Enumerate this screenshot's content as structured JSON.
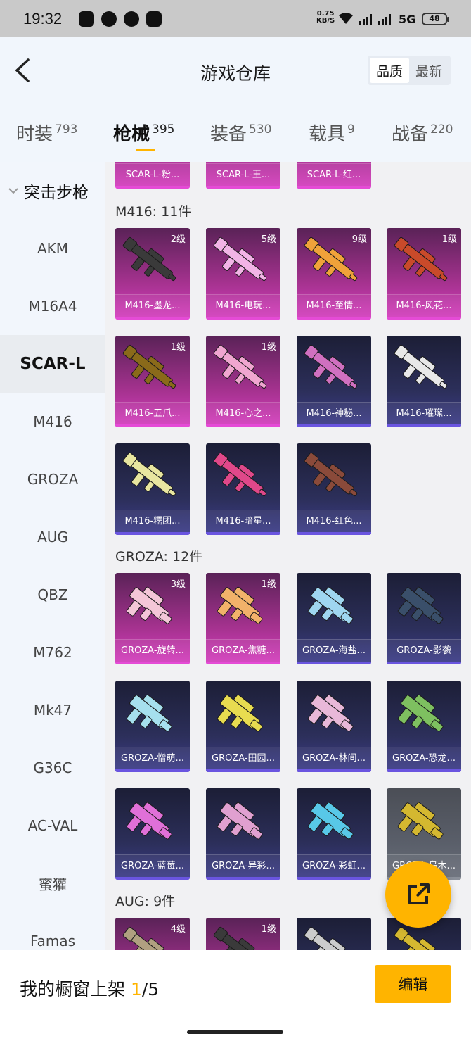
{
  "status_bar": {
    "time": "19:32",
    "speed": "0.75",
    "speed_unit": "KB/S",
    "network": "5G",
    "battery": "48"
  },
  "header": {
    "title": "游戏仓库",
    "sort_options": [
      "品质",
      "最新"
    ],
    "active_sort": "品质"
  },
  "tabs": [
    {
      "label": "时装",
      "count": "793"
    },
    {
      "label": "枪械",
      "count": "395"
    },
    {
      "label": "装备",
      "count": "530"
    },
    {
      "label": "载具",
      "count": "9"
    },
    {
      "label": "战备",
      "count": "220"
    }
  ],
  "active_tab": "枪械",
  "sidebar": {
    "group": "突击步枪",
    "items": [
      "AKM",
      "M16A4",
      "SCAR-L",
      "M416",
      "GROZA",
      "AUG",
      "QBZ",
      "M762",
      "Mk47",
      "G36C",
      "AC-VAL",
      "蜜獾",
      "Famas"
    ],
    "active": "SCAR-L"
  },
  "top_partial_cards": [
    {
      "name": "SCAR-L-粉...",
      "style": "pink"
    },
    {
      "name": "SCAR-L-王...",
      "style": "pink"
    },
    {
      "name": "SCAR-L-红...",
      "style": "pink"
    }
  ],
  "sections": [
    {
      "title": "M416: 11件",
      "items": [
        {
          "name": "M416-墨龙...",
          "level": "2级",
          "style": "pink",
          "color": "#3a3a3a"
        },
        {
          "name": "M416-电玩...",
          "level": "5级",
          "style": "pink",
          "color": "#f2b4e6"
        },
        {
          "name": "M416-至情...",
          "level": "9级",
          "style": "pink",
          "color": "#f0a23a"
        },
        {
          "name": "M416-风花...",
          "level": "1级",
          "style": "pink",
          "color": "#c94a2a"
        },
        {
          "name": "M416-五爪...",
          "level": "1级",
          "style": "pink",
          "color": "#8a6a1a"
        },
        {
          "name": "M416-心之...",
          "level": "1级",
          "style": "pink",
          "color": "#f0a6d0"
        },
        {
          "name": "M416-神秘...",
          "level": "",
          "style": "blue",
          "color": "#d070c0"
        },
        {
          "name": "M416-璀璨...",
          "level": "",
          "style": "blue",
          "color": "#e8e8e8"
        },
        {
          "name": "M416-糯团...",
          "level": "",
          "style": "blue",
          "color": "#e8e6a0"
        },
        {
          "name": "M416-暗星...",
          "level": "",
          "style": "blue",
          "color": "#e0488a"
        },
        {
          "name": "M416-红色...",
          "level": "",
          "style": "blue",
          "color": "#8a4a3a"
        }
      ]
    },
    {
      "title": "GROZA: 12件",
      "items": [
        {
          "name": "GROZA-旋转...",
          "level": "3级",
          "style": "pink",
          "color": "#f4c6d8"
        },
        {
          "name": "GROZA-焦糖...",
          "level": "1级",
          "style": "pink",
          "color": "#f2b26a"
        },
        {
          "name": "GROZA-海盐...",
          "level": "",
          "style": "blue",
          "color": "#9fd6f0"
        },
        {
          "name": "GROZA-影袭",
          "level": "",
          "style": "blue",
          "color": "#3a4f6a"
        },
        {
          "name": "GROZA-憎萌...",
          "level": "",
          "style": "blue",
          "color": "#a6e0ee"
        },
        {
          "name": "GROZA-田园...",
          "level": "",
          "style": "blue",
          "color": "#e8dc50"
        },
        {
          "name": "GROZA-林间...",
          "level": "",
          "style": "blue",
          "color": "#e8b8d8"
        },
        {
          "name": "GROZA-恐龙...",
          "level": "",
          "style": "blue",
          "color": "#7ec060"
        },
        {
          "name": "GROZA-蓝莓...",
          "level": "",
          "style": "blue",
          "color": "#e070d8"
        },
        {
          "name": "GROZA-异彩...",
          "level": "",
          "style": "blue",
          "color": "#e0a0d0"
        },
        {
          "name": "GROZA-彩虹...",
          "level": "",
          "style": "blue",
          "color": "#58c8e8"
        },
        {
          "name": "GROZA-乌木...",
          "level": "",
          "style": "grey",
          "color": "#d4b830"
        }
      ]
    },
    {
      "title": "AUG: 9件",
      "items": [
        {
          "name": "",
          "level": "4级",
          "style": "pink",
          "color": "#b0a080"
        },
        {
          "name": "",
          "level": "1级",
          "style": "pink",
          "color": "#3a3a3a"
        },
        {
          "name": "",
          "level": "",
          "style": "blue",
          "color": "#cccccc"
        },
        {
          "name": "",
          "level": "",
          "style": "blue",
          "color": "#d4b830"
        }
      ]
    }
  ],
  "bottom_bar": {
    "showcase_label": "我的橱窗上架",
    "showcase_count": "1",
    "showcase_total": "/5",
    "edit_label": "编辑"
  }
}
